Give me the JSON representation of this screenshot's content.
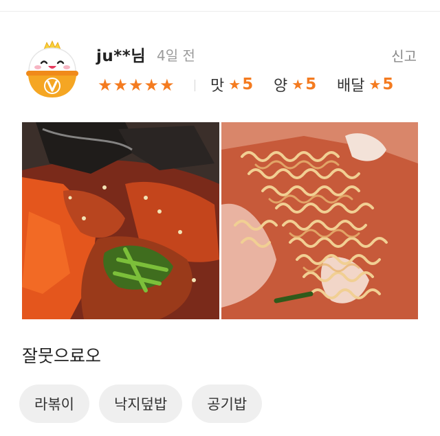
{
  "review": {
    "username": "ju**님",
    "date": "4일 전",
    "report_label": "신고",
    "overall_rating": 5,
    "overall_stars": "★★★★★",
    "ratings": [
      {
        "label": "맛",
        "star": "★",
        "value": "5"
      },
      {
        "label": "양",
        "star": "★",
        "value": "5"
      },
      {
        "label": "배달",
        "star": "★",
        "value": "5"
      }
    ],
    "text": "잘뭇으료오",
    "menu_tags": [
      "라볶이",
      "낙지덮밥",
      "공기밥"
    ]
  },
  "colors": {
    "accent": "#f47b20",
    "tag_bg": "#efefef",
    "avatar_bowl": "#f5a623",
    "avatar_crown": "#f8d23a"
  },
  "icons": {
    "avatar": "vip-rice-bowl-icon",
    "star": "star-icon"
  }
}
